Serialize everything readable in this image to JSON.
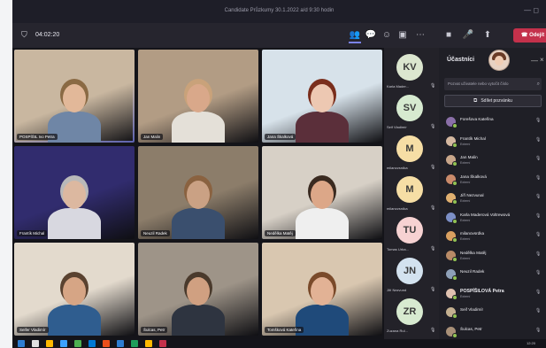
{
  "window": {
    "title": "Candidate Průzkumy 30.1.2022 a/d 9:30 hodin",
    "win_controls": "—   ◻"
  },
  "toolbar": {
    "timer": "04:02:20",
    "leave_label": "Odejít",
    "icons": [
      "people-icon",
      "chat-icon",
      "reactions-icon",
      "rooms-icon",
      "more-icon",
      "camera-icon",
      "mic-icon",
      "share-icon"
    ]
  },
  "tiles": [
    {
      "name": "POSPÍŠIL Ivo Petra",
      "bg": "#c9b7a0",
      "skin": "#e2b899",
      "shirt": "#6f86a6",
      "hair": "#8a6a44",
      "speaking": true
    },
    {
      "name": "Jan Malin",
      "bg": "#b29c84",
      "skin": "#d9a88a",
      "shirt": "#e4e0d8",
      "hair": "#c9a27a",
      "speaking": false
    },
    {
      "name": "Jana Škalková",
      "bg": "#d7e2ea",
      "skin": "#edc8b2",
      "shirt": "#5b2f3a",
      "hair": "#7a2e1c",
      "speaking": false
    },
    {
      "name": "Frantík Michal",
      "bg": "#312c6e",
      "skin": "#dcb8a0",
      "shirt": "#d8d8e0",
      "hair": "#b9b9b9",
      "speaking": false
    },
    {
      "name": "Neuzil Radek",
      "bg": "#8c7d6a",
      "skin": "#caa184",
      "shirt": "#3a4f6e",
      "hair": "#8a6240",
      "speaking": false
    },
    {
      "name": "Nedělka Matěj",
      "bg": "#d7d0c6",
      "skin": "#dca788",
      "shirt": "#efefef",
      "hair": "#3a2a20",
      "speaking": false
    },
    {
      "name": "Seifer Vladimír",
      "bg": "#e3dacd",
      "skin": "#d6a585",
      "shirt": "#2f5d8f",
      "hair": "#5a4230",
      "speaking": false
    },
    {
      "name": "Šulcas, Petr",
      "bg": "#9e9488",
      "skin": "#d0a081",
      "shirt": "#2e3440",
      "hair": "#4a3a2c",
      "speaking": false
    },
    {
      "name": "Tomšková Kateřina",
      "bg": "#d9c7b0",
      "skin": "#e2b295",
      "shirt": "#1f4a7a",
      "hair": "#7a4a2a",
      "speaking": false
    }
  ],
  "rail": [
    {
      "initials": "KV",
      "label": "Karla Mader...",
      "color": "#dbe6cf"
    },
    {
      "initials": "SV",
      "label": "Seif Vladimír",
      "color": "#d6ead0"
    },
    {
      "initials": "M",
      "label": "milanovsrdka",
      "color": "#f6dea5"
    },
    {
      "initials": "M",
      "label": "milanovsrdka",
      "color": "#f6dea5"
    },
    {
      "initials": "TU",
      "label": "Tomas Urba...",
      "color": "#f6d2d2"
    },
    {
      "initials": "JN",
      "label": "Jiří Nezvund",
      "color": "#d3e2ef"
    },
    {
      "initials": "ZR",
      "label": "Zuzana Rul...",
      "color": "#d7ead0"
    }
  ],
  "panel": {
    "title": "Účastníci",
    "search_placeholder": "Pozvat uživatele nebo vytočit číslo",
    "share_label": "Sdílet pozvánku",
    "participants": [
      {
        "name": "Forešova Kateřina",
        "role": "",
        "bold": false,
        "av": "#8a6fa8",
        "mic": "🎙"
      },
      {
        "name": "Frantík Michal",
        "role": "Externí",
        "bold": false,
        "av": "#d4b8a0",
        "mic": "🎙"
      },
      {
        "name": "Jan Malin",
        "role": "Externí",
        "bold": false,
        "av": "#c8a68a",
        "mic": "🎙"
      },
      {
        "name": "Jana Škalková",
        "role": "Externí",
        "bold": false,
        "av": "#c98a6a",
        "mic": "🎙"
      },
      {
        "name": "Jiří Nezvunal",
        "role": "Externí",
        "bold": false,
        "av": "#e0b070",
        "mic": "🎙"
      },
      {
        "name": "Karla Maderová Voltrewová",
        "role": "Externí",
        "bold": false,
        "av": "#7c8fc6",
        "mic": "🎙"
      },
      {
        "name": "milanovsrdka",
        "role": "Externí",
        "bold": false,
        "av": "#d9a060",
        "mic": "🎙"
      },
      {
        "name": "Nedělka Matěj",
        "role": "Externí",
        "bold": false,
        "av": "#b88a66",
        "mic": "🎙"
      },
      {
        "name": "Neuzil Radek",
        "role": "",
        "bold": false,
        "av": "#8ea0b8",
        "mic": "🎙"
      },
      {
        "name": "POSPÍŠILOVÁ Petra",
        "role": "Externí",
        "bold": true,
        "av": "#e0c2b0",
        "mic": "🎙"
      },
      {
        "name": "Seif Vladimír",
        "role": "",
        "bold": false,
        "av": "#c4b090",
        "mic": "🎙"
      },
      {
        "name": "Šulcas, Petr",
        "role": "",
        "bold": false,
        "av": "#a89078",
        "mic": "🎙"
      }
    ]
  },
  "taskbar": {
    "clock": "12:20"
  },
  "colors": {
    "accent": "#7b83eb",
    "leave": "#c4314b",
    "available": "#92c353"
  }
}
